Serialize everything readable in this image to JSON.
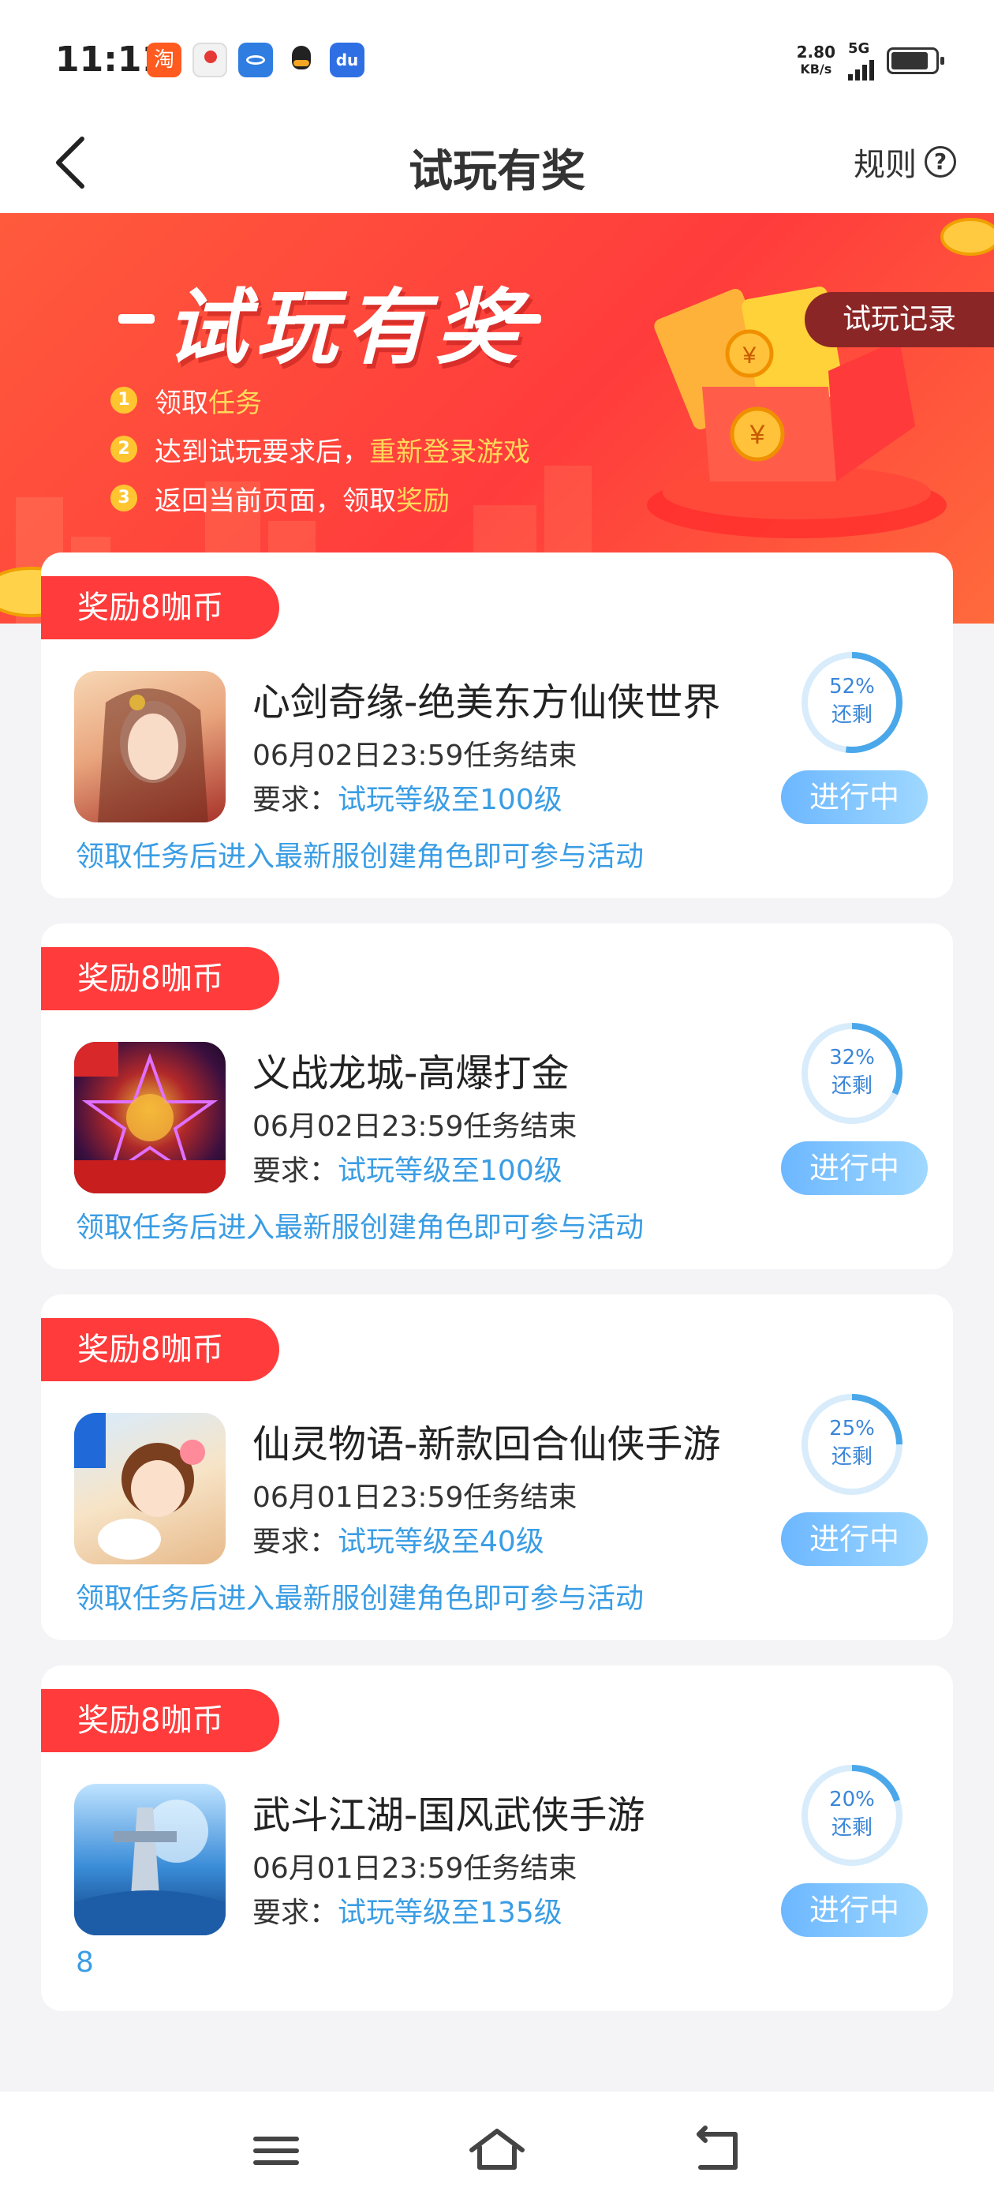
{
  "status_bar": {
    "time": "11:11",
    "speed_value": "2.80",
    "speed_unit": "KB/s",
    "network": "5G",
    "battery_level": 0.85,
    "app_icons": [
      "taobao-icon",
      "maps-icon",
      "browser-icon",
      "qq-icon",
      "baidu-icon"
    ]
  },
  "header": {
    "title": "试玩有奖",
    "rules_label": "规则",
    "rules_icon": "?"
  },
  "banner": {
    "title": "试玩有奖",
    "record_button": "试玩记录",
    "steps": [
      {
        "num": "1",
        "text": "领取",
        "highlight": "任务"
      },
      {
        "num": "2",
        "text": "达到试玩要求后，",
        "highlight": "重新登录游戏"
      },
      {
        "num": "3",
        "text": "返回当前页面，领取",
        "highlight": "奖励"
      }
    ]
  },
  "tasks": [
    {
      "reward": "奖励8咖币",
      "name": "心剑奇缘-绝美东方仙侠世界",
      "deadline": "06月02日23:59任务结束",
      "req_label": "要求：",
      "req_value": "试玩等级至100级",
      "note": "领取任务后进入最新服创建角色即可参与活动",
      "remaining_percent": "52%",
      "remaining_label": "还剩",
      "remaining": 0.52,
      "status": "进行中"
    },
    {
      "reward": "奖励8咖币",
      "name": "义战龙城-高爆打金",
      "deadline": "06月02日23:59任务结束",
      "req_label": "要求：",
      "req_value": "试玩等级至100级",
      "note": "领取任务后进入最新服创建角色即可参与活动",
      "remaining_percent": "32%",
      "remaining_label": "还剩",
      "remaining": 0.32,
      "status": "进行中"
    },
    {
      "reward": "奖励8咖币",
      "name": "仙灵物语-新款回合仙侠手游",
      "deadline": "06月01日23:59任务结束",
      "req_label": "要求：",
      "req_value": "试玩等级至40级",
      "note": "领取任务后进入最新服创建角色即可参与活动",
      "remaining_percent": "25%",
      "remaining_label": "还剩",
      "remaining": 0.25,
      "status": "进行中"
    },
    {
      "reward": "奖励8咖币",
      "name": "武斗江湖-国风武侠手游",
      "deadline": "06月01日23:59任务结束",
      "req_label": "要求：",
      "req_value": "试玩等级至135级",
      "note": "8",
      "remaining_percent": "20%",
      "remaining_label": "还剩",
      "remaining": 0.2,
      "status": "进行中"
    }
  ],
  "navigation": {
    "buttons": [
      "menu-icon",
      "home-icon",
      "back-icon"
    ]
  }
}
